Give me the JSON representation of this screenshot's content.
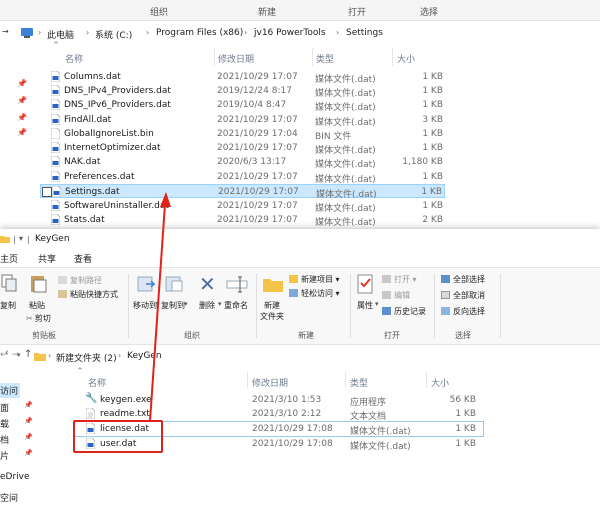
{
  "top_window": {
    "ribbon_groups": [
      "组织",
      "新建",
      "打开",
      "选择"
    ],
    "breadcrumb": [
      "此电脑",
      "系统 (C:)",
      "Program Files (x86)",
      "jv16 PowerTools",
      "Settings"
    ],
    "columns": {
      "name": "名称",
      "date": "修改日期",
      "type": "类型",
      "size": "大小"
    },
    "files": [
      {
        "name": "Columns.dat",
        "date": "2021/10/29 17:07",
        "type": "媒体文件(.dat)",
        "size": "1 KB"
      },
      {
        "name": "DNS_IPv4_Providers.dat",
        "date": "2019/12/24 8:17",
        "type": "媒体文件(.dat)",
        "size": "1 KB"
      },
      {
        "name": "DNS_IPv6_Providers.dat",
        "date": "2019/10/4 8:47",
        "type": "媒体文件(.dat)",
        "size": "1 KB"
      },
      {
        "name": "FindAll.dat",
        "date": "2021/10/29 17:07",
        "type": "媒体文件(.dat)",
        "size": "3 KB"
      },
      {
        "name": "GlobalIgnoreList.bin",
        "date": "2021/10/29 17:04",
        "type": "BIN 文件",
        "size": "1 KB"
      },
      {
        "name": "InternetOptimizer.dat",
        "date": "2021/10/29 17:07",
        "type": "媒体文件(.dat)",
        "size": "1 KB"
      },
      {
        "name": "NAK.dat",
        "date": "2020/6/3 13:17",
        "type": "媒体文件(.dat)",
        "size": "1,180 KB"
      },
      {
        "name": "Preferences.dat",
        "date": "2021/10/29 17:07",
        "type": "媒体文件(.dat)",
        "size": "1 KB"
      },
      {
        "name": "Settings.dat",
        "date": "2021/10/29 17:07",
        "type": "媒体文件(.dat)",
        "size": "1 KB"
      },
      {
        "name": "SoftwareUninstaller.dat",
        "date": "2021/10/29 17:07",
        "type": "媒体文件(.dat)",
        "size": "1 KB"
      },
      {
        "name": "Stats.dat",
        "date": "2021/10/29 17:07",
        "type": "媒体文件(.dat)",
        "size": "2 KB"
      }
    ]
  },
  "bottom_window": {
    "title": "KeyGen",
    "tabs": [
      "主页",
      "共享",
      "查看"
    ],
    "ribbon": {
      "copy": "复制",
      "paste": "粘贴",
      "copy_path": "复制路径",
      "paste_shortcut": "粘贴快捷方式",
      "cut": "剪切",
      "clipboard": "剪贴板",
      "move_to": "移动到",
      "copy_to": "复制到",
      "delete": "删除",
      "rename": "重命名",
      "organize": "组织",
      "new_item": "新建项目",
      "easy_access": "轻松访问",
      "new_folder_line1": "新建",
      "new_folder_line2": "文件夹",
      "new": "新建",
      "open": "打开",
      "edit": "编辑",
      "history": "历史记录",
      "properties": "属性",
      "open_group": "打开",
      "select_all": "全部选择",
      "select_none": "全部取消",
      "invert": "反向选择",
      "select_group": "选择"
    },
    "breadcrumb": [
      "新建文件夹 (2)",
      "KeyGen"
    ],
    "nav": [
      "访问",
      "面",
      "载",
      "档",
      "片",
      "eDrive",
      "空间"
    ],
    "columns": {
      "name": "名称",
      "date": "修改日期",
      "type": "类型",
      "size": "大小"
    },
    "files": [
      {
        "name": "keygen.exe",
        "date": "2021/3/10 1:53",
        "type": "应用程序",
        "size": "56 KB"
      },
      {
        "name": "readme.txt",
        "date": "2021/3/10 2:12",
        "type": "文本文档",
        "size": "1 KB"
      },
      {
        "name": "license.dat",
        "date": "2021/10/29 17:08",
        "type": "媒体文件(.dat)",
        "size": "1 KB"
      },
      {
        "name": "user.dat",
        "date": "2021/10/29 17:08",
        "type": "媒体文件(.dat)",
        "size": "1 KB"
      }
    ]
  },
  "colors": {
    "selection": "#cce8ff",
    "annotation": "#e0231a",
    "folder": "#f3c447",
    "dat_icon": "#2b63c9"
  },
  "icons": [
    "folder-icon",
    "dat-file-icon",
    "bin-file-icon",
    "exe-icon",
    "txt-icon",
    "pin-icon",
    "red-arrow"
  ]
}
